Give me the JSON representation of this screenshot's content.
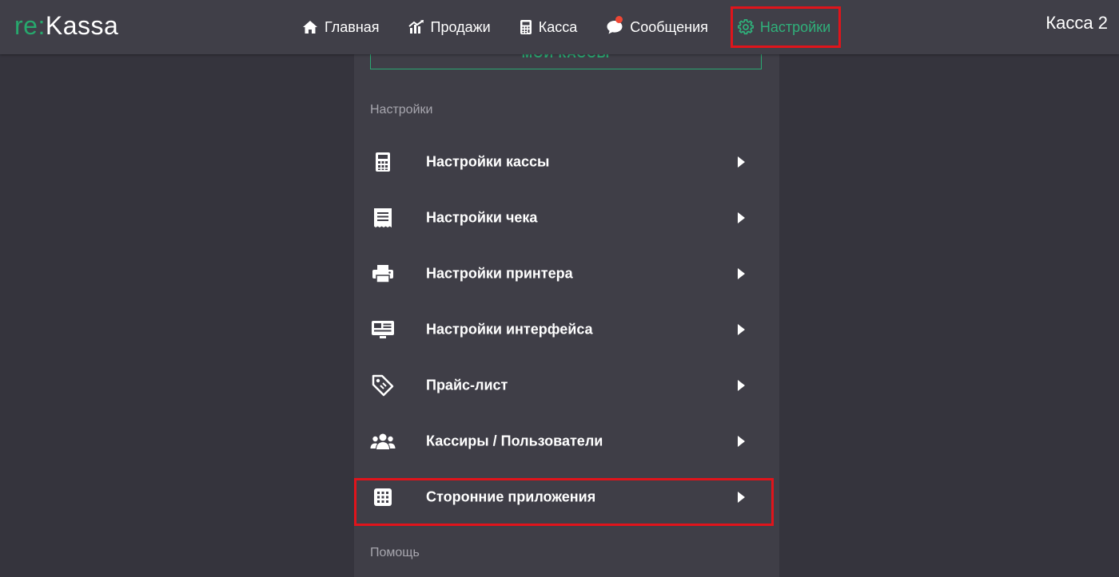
{
  "app": {
    "logo_re": "re",
    "logo_colon": ":",
    "logo_kassa": "Kassa",
    "current_kassa": "Касса 2"
  },
  "nav": {
    "items": [
      {
        "label": "Главная",
        "icon": "home-icon"
      },
      {
        "label": "Продажи",
        "icon": "sales-chart-icon"
      },
      {
        "label": "Касса",
        "icon": "calculator-icon"
      },
      {
        "label": "Сообщения",
        "icon": "chat-bubble-icon",
        "has_notification": true
      },
      {
        "label": "Настройки",
        "icon": "gear-icon",
        "active": true
      }
    ]
  },
  "panel": {
    "my_kassas_label": "МОИ КАССЫ",
    "section_settings": "Настройки",
    "section_help": "Помощь",
    "items": [
      {
        "label": "Настройки кассы",
        "icon": "calculator-icon"
      },
      {
        "label": "Настройки чека",
        "icon": "receipt-icon"
      },
      {
        "label": "Настройки принтера",
        "icon": "printer-icon"
      },
      {
        "label": "Настройки интерфейса",
        "icon": "interface-icon"
      },
      {
        "label": "Прайс-лист",
        "icon": "price-tag-icon"
      },
      {
        "label": "Кассиры / Пользователи",
        "icon": "users-icon"
      },
      {
        "label": "Сторонние приложения",
        "icon": "apps-grid-icon",
        "highlighted": true
      }
    ]
  },
  "colors": {
    "accent": "#2aa872",
    "highlight": "#e0141b",
    "background": "#35343d",
    "panel": "#3f3e47",
    "topbar": "#403f48"
  }
}
